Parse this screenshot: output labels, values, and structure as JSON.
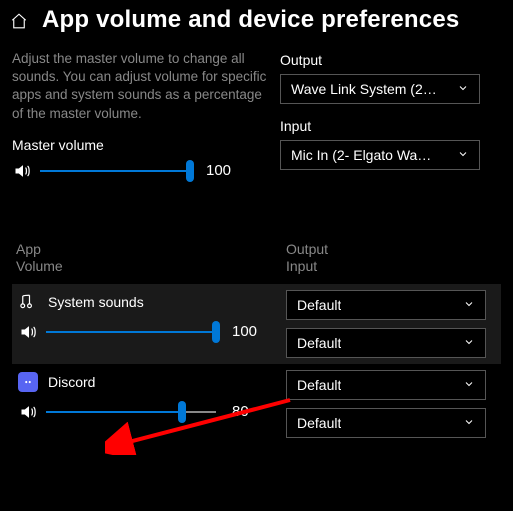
{
  "header": {
    "title": "App volume and device preferences"
  },
  "description": "Adjust the master volume to change all sounds. You can adjust volume for specific apps and system sounds as a percentage of the master volume.",
  "master": {
    "label": "Master volume",
    "value": "100",
    "pct": 100
  },
  "output": {
    "label": "Output",
    "selected": "Wave Link System (2…"
  },
  "input": {
    "label": "Input",
    "selected": "Mic In (2- Elgato Wa…"
  },
  "columns": {
    "left1": "App",
    "left2": "Volume",
    "right1": "Output",
    "right2": "Input"
  },
  "apps": [
    {
      "name": "System sounds",
      "value": "100",
      "pct": 100,
      "output": "Default",
      "input": "Default",
      "icon": "system"
    },
    {
      "name": "Discord",
      "value": "80",
      "pct": 80,
      "output": "Default",
      "input": "Default",
      "icon": "discord"
    }
  ]
}
